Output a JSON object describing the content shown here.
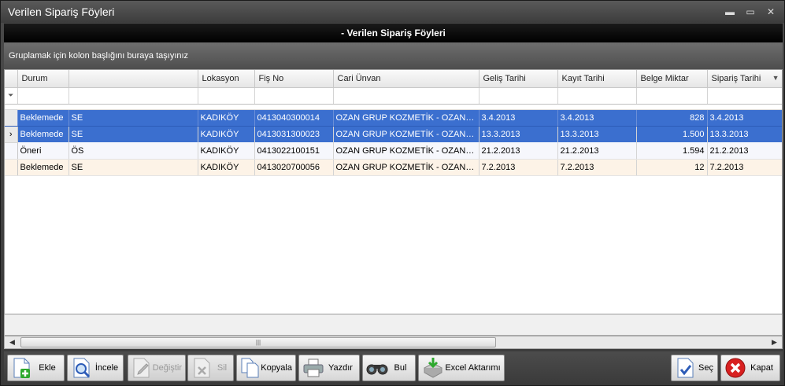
{
  "window": {
    "title": "Verilen Sipariş Föyleri"
  },
  "header": {
    "title": "- Verilen Sipariş Föyleri"
  },
  "group_panel": {
    "hint": "Gruplamak için kolon başlığını buraya taşıyınız"
  },
  "grid": {
    "columns": [
      "Durum",
      "",
      "Lokasyon",
      "Fiş No",
      "Cari Ünvan",
      "Geliş Tarihi",
      "Kayıt Tarihi",
      "Belge Miktar",
      "Sipariş Tarihi"
    ],
    "rows": [
      {
        "durum": "Beklemede",
        "kod": "SE",
        "lokasyon": "KADIKÖY",
        "fis_no": "0413040300014",
        "cari": "OZAN GRUP  KOZMETİK - OZAN O...",
        "gelis": "3.4.2013",
        "kayit": "3.4.2013",
        "miktar": "828",
        "siparis": "3.4.2013"
      },
      {
        "durum": "Beklemede",
        "kod": "SE",
        "lokasyon": "KADIKÖY",
        "fis_no": "0413031300023",
        "cari": "OZAN GRUP  KOZMETİK - OZAN O...",
        "gelis": "13.3.2013",
        "kayit": "13.3.2013",
        "miktar": "1.500",
        "siparis": "13.3.2013"
      },
      {
        "durum": "Öneri",
        "kod": "ÖS",
        "lokasyon": "KADIKÖY",
        "fis_no": "0413022100151",
        "cari": "OZAN GRUP  KOZMETİK - OZAN O...",
        "gelis": "21.2.2013",
        "kayit": "21.2.2013",
        "miktar": "1.594",
        "siparis": "21.2.2013"
      },
      {
        "durum": "Beklemede",
        "kod": "SE",
        "lokasyon": "KADIKÖY",
        "fis_no": "0413020700056",
        "cari": "OZAN GRUP  KOZMETİK - OZAN O...",
        "gelis": "7.2.2013",
        "kayit": "7.2.2013",
        "miktar": "12",
        "siparis": "7.2.2013"
      }
    ]
  },
  "toolbar": {
    "ekle": "Ekle",
    "incele": "İncele",
    "degistir": "Değiştir",
    "sil": "Sil",
    "kopyala": "Kopyala",
    "yazdir": "Yazdır",
    "bul": "Bul",
    "excel": "Excel Aktarımı",
    "sec": "Seç",
    "kapat": "Kapat"
  },
  "icons": {
    "ekle": "add-document-icon",
    "incele": "magnifier-document-icon",
    "degistir": "edit-document-icon",
    "sil": "delete-document-icon",
    "kopyala": "copy-document-icon",
    "yazdir": "printer-icon",
    "bul": "binoculars-icon",
    "excel": "excel-export-icon",
    "sec": "select-check-icon",
    "kapat": "close-x-icon"
  },
  "colors": {
    "selection": "#3b6fcf",
    "alt_row": "#fdf3e7",
    "header_bar": "#000000"
  }
}
